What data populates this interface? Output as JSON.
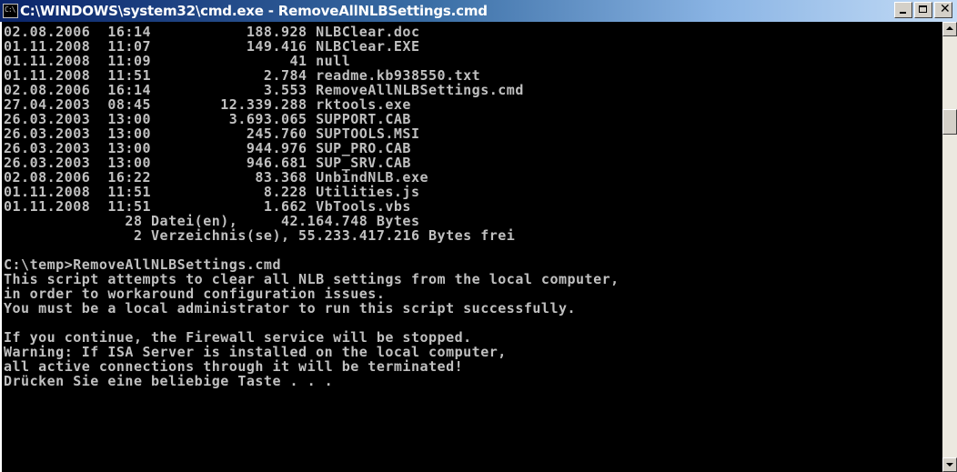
{
  "window": {
    "title": "C:\\WINDOWS\\system32\\cmd.exe - RemoveAllNLBSettings.cmd",
    "icon_text": "C:\\",
    "icon": "console-icon",
    "buttons": [
      "minimize-icon",
      "maximize-icon",
      "close-icon"
    ],
    "close_glyph": "✕"
  },
  "console": {
    "lines": [
      "02.08.2006  16:14           188.928 NLBClear.doc",
      "01.11.2008  11:07           149.416 NLBClear.EXE",
      "01.11.2008  11:09                41 null",
      "01.11.2008  11:51             2.784 readme.kb938550.txt",
      "02.08.2006  16:14             3.553 RemoveAllNLBSettings.cmd",
      "27.04.2003  08:45        12.339.288 rktools.exe",
      "26.03.2003  13:00         3.693.065 SUPPORT.CAB",
      "26.03.2003  13:00           245.760 SUPTOOLS.MSI",
      "26.03.2003  13:00           944.976 SUP_PRO.CAB",
      "26.03.2003  13:00           946.681 SUP_SRV.CAB",
      "02.08.2006  16:22            83.368 UnbindNLB.exe",
      "01.11.2008  11:51             8.228 Utilities.js",
      "01.11.2008  11:51             1.662 VbTools.vbs",
      "              28 Datei(en),     42.164.748 Bytes",
      "               2 Verzeichnis(se), 55.233.417.216 Bytes frei",
      "",
      "C:\\temp>RemoveAllNLBSettings.cmd",
      "This script attempts to clear all NLB settings from the local computer,",
      "in order to workaround configuration issues.",
      "You must be a local administrator to run this script successfully.",
      "",
      "If you continue, the Firewall service will be stopped.",
      "Warning: If ISA Server is installed on the local computer,",
      "all active connections through it will be terminated!",
      "Drücken Sie eine beliebige Taste . . ."
    ]
  },
  "colors": {
    "console_bg": "#000000",
    "console_text": "#c0c0c0",
    "titlebar_start": "#0a246a",
    "titlebar_end": "#c4dcf6"
  }
}
